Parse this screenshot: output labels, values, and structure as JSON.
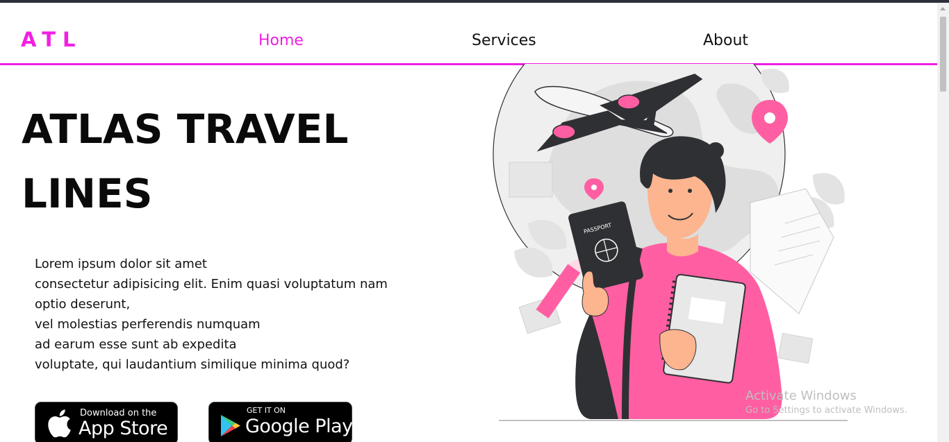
{
  "nav": {
    "logo": "ATL",
    "items": [
      {
        "label": "Home",
        "active": true
      },
      {
        "label": "Services",
        "active": false
      },
      {
        "label": "About",
        "active": false
      }
    ]
  },
  "hero": {
    "title_lines": [
      "ATLAS TRAVEL",
      "LINES"
    ],
    "description_lines": [
      "Lorem ipsum dolor sit amet",
      "consectetur adipisicing elit. Enim quasi voluptatum nam",
      "optio deserunt,",
      "vel molestias perferendis numquam",
      "ad earum esse sunt ab expedita",
      "voluptate, qui laudantium similique minima quod?"
    ]
  },
  "stores": {
    "appstore": {
      "small": "Download on the",
      "big": "App Store",
      "icon": "apple-icon"
    },
    "googleplay": {
      "small": "GET IT ON",
      "big": "Google Play",
      "icon": "google-play-icon"
    }
  },
  "illustration": {
    "passport_text": "PASSPORT"
  },
  "watermark": {
    "title": "Activate Windows",
    "subtitle": "Go to Settings to activate Windows."
  },
  "colors": {
    "accent": "#ee1fe0",
    "illustration_pink": "#ff5fa2",
    "topbar": "#2b3038"
  }
}
